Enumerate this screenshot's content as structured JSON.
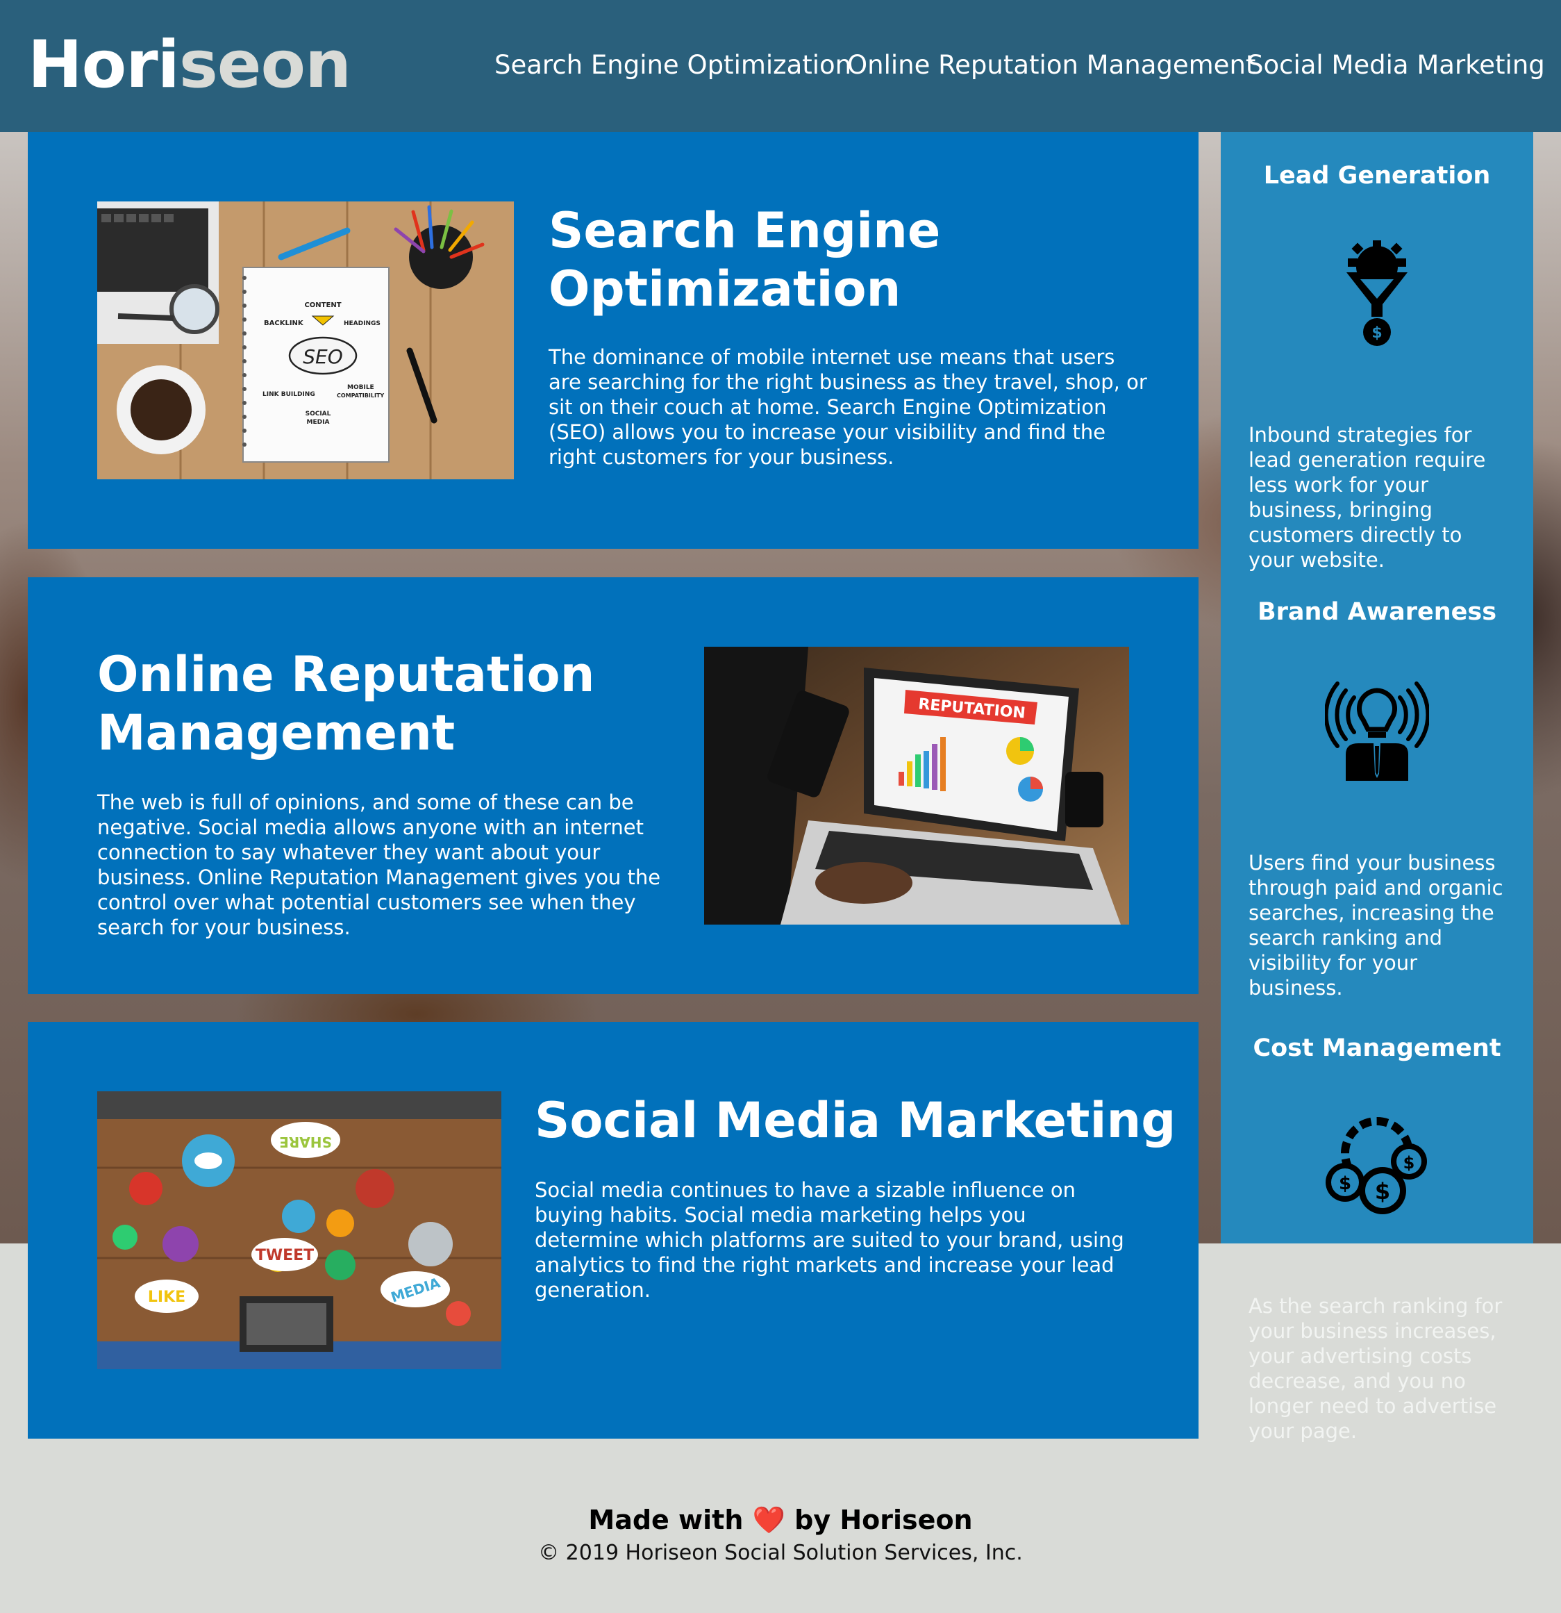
{
  "header": {
    "logo_main": "Hori",
    "logo_accent": "seon",
    "nav": [
      {
        "label": "Search Engine Optimization"
      },
      {
        "label": "Online Reputation Management"
      },
      {
        "label": "Social Media Marketing"
      }
    ]
  },
  "content": [
    {
      "title": "Search Engine Optimization",
      "text": "The dominance of mobile internet use means that users are searching for the right business as they travel, shop, or sit on their couch at home. Search Engine Optimization (SEO) allows you to increase your visibility and find the right customers for your business.",
      "image_labels": [
        "CONTENT",
        "BACKLINK",
        "HEADINGS",
        "SEO",
        "LINK BUILDING",
        "MOBILE",
        "COMPATIBILITY",
        "SOCIAL",
        "MEDIA"
      ]
    },
    {
      "title": "Online Reputation Management",
      "text": "The web is full of opinions, and some of these can be negative. Social media allows anyone with an internet connection to say whatever they want about your business. Online Reputation Management gives you the control over what potential customers see when they search for your business.",
      "image_labels": [
        "REPUTATION"
      ]
    },
    {
      "title": "Social Media Marketing",
      "text": "Social media continues to have a sizable influence on buying habits. Social media marketing helps you determine which platforms are suited to your brand, using analytics to find the right markets and increase your lead generation.",
      "image_labels": [
        "SHARE",
        "TWEET",
        "LIKE",
        "MEDIA"
      ]
    }
  ],
  "benefits": [
    {
      "title": "Lead Generation",
      "icon": "lead-generation-icon",
      "text": "Inbound strategies for lead generation require less work for your business, bringing customers directly to your website."
    },
    {
      "title": "Brand Awareness",
      "icon": "brand-awareness-icon",
      "text": "Users find your business through paid and organic searches, increasing the search ranking and visibility for your business."
    },
    {
      "title": "Cost Management",
      "icon": "cost-management-icon",
      "text": "As the search ranking for your business increases, your advertising costs decrease, and you no longer need to advertise your page."
    }
  ],
  "footer": {
    "made_prefix": "Made with ",
    "heart": "❤️",
    "made_suffix": " by Horiseon",
    "copyright": "© 2019 Horiseon Social Solution Services, Inc."
  },
  "colors": {
    "header_bg": "#2a607c",
    "card_bg": "#0171bb",
    "sidebar_bg": "#2589bd",
    "page_bg": "#d9dbd7"
  }
}
